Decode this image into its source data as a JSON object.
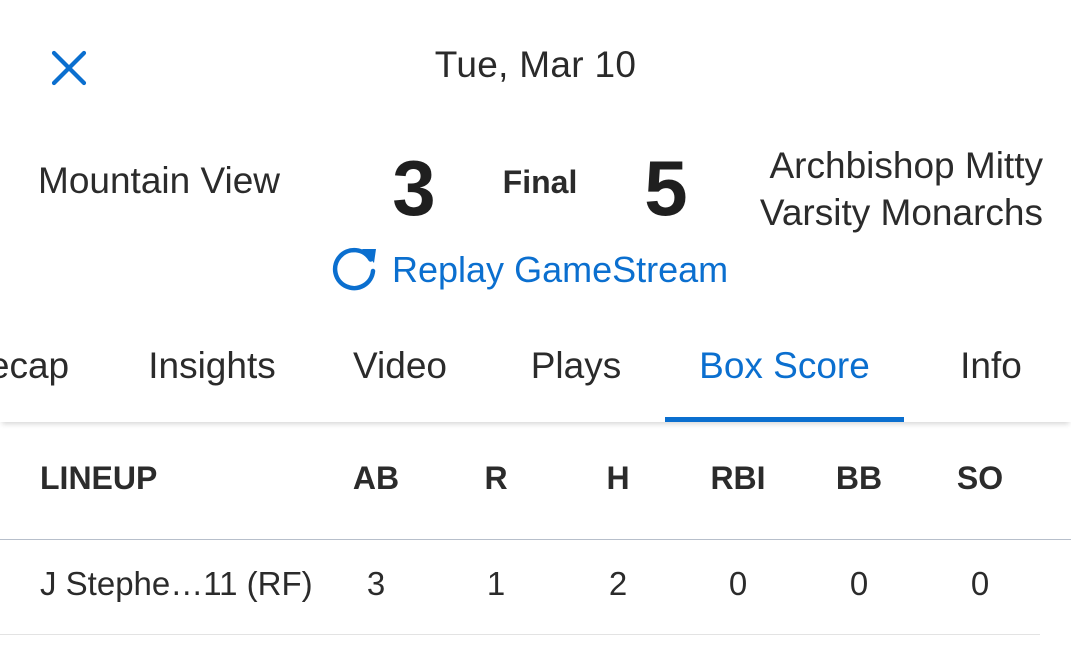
{
  "header": {
    "close_icon": "close-icon",
    "date": "Tue, Mar 10"
  },
  "game": {
    "home_team": "Mountain View",
    "home_score": "3",
    "status": "Final",
    "away_score": "5",
    "away_team_line1": "Archbishop Mitty",
    "away_team_line2": "Varsity Monarchs"
  },
  "replay": {
    "icon": "replay-icon",
    "label": "Replay GameStream"
  },
  "tabs": [
    {
      "label": "ecap"
    },
    {
      "label": "Insights"
    },
    {
      "label": "Video"
    },
    {
      "label": "Plays"
    },
    {
      "label": "Box Score",
      "active": true
    },
    {
      "label": "Info"
    }
  ],
  "box_score": {
    "columns": [
      "LINEUP",
      "AB",
      "R",
      "H",
      "RBI",
      "BB",
      "SO"
    ],
    "rows": [
      {
        "player": "J Stephe…11 (RF)",
        "ab": "3",
        "r": "1",
        "h": "2",
        "rbi": "0",
        "bb": "0",
        "so": "0"
      }
    ]
  },
  "colors": {
    "accent": "#0b6fcf",
    "text": "#2b2b2b",
    "divider": "#b7bfcb"
  }
}
